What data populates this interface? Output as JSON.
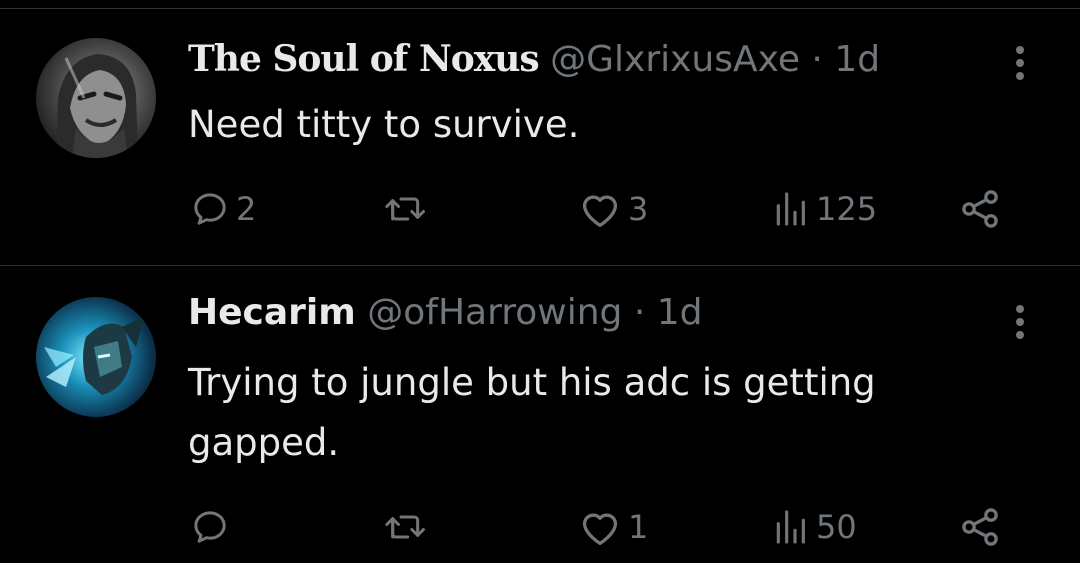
{
  "colors": {
    "background": "#000000",
    "text_primary": "#e7e9ea",
    "text_secondary": "#71767b",
    "divider": "#2f3336"
  },
  "tweets": [
    {
      "display_name": "The Soul of Noxus",
      "handle": "@GlxrixusAxe",
      "separator": "·",
      "time": "1d",
      "text": "Need titty to survive.",
      "avatar_icon": "noxus-avatar",
      "replies": "2",
      "retweets": "",
      "likes": "3",
      "views": "125"
    },
    {
      "display_name": "Hecarim",
      "handle": "@ofHarrowing",
      "separator": "·",
      "time": "1d",
      "text": "Trying to jungle but his adc is getting gapped.",
      "avatar_icon": "hecarim-avatar",
      "replies": "",
      "retweets": "",
      "likes": "1",
      "views": "50"
    }
  ]
}
